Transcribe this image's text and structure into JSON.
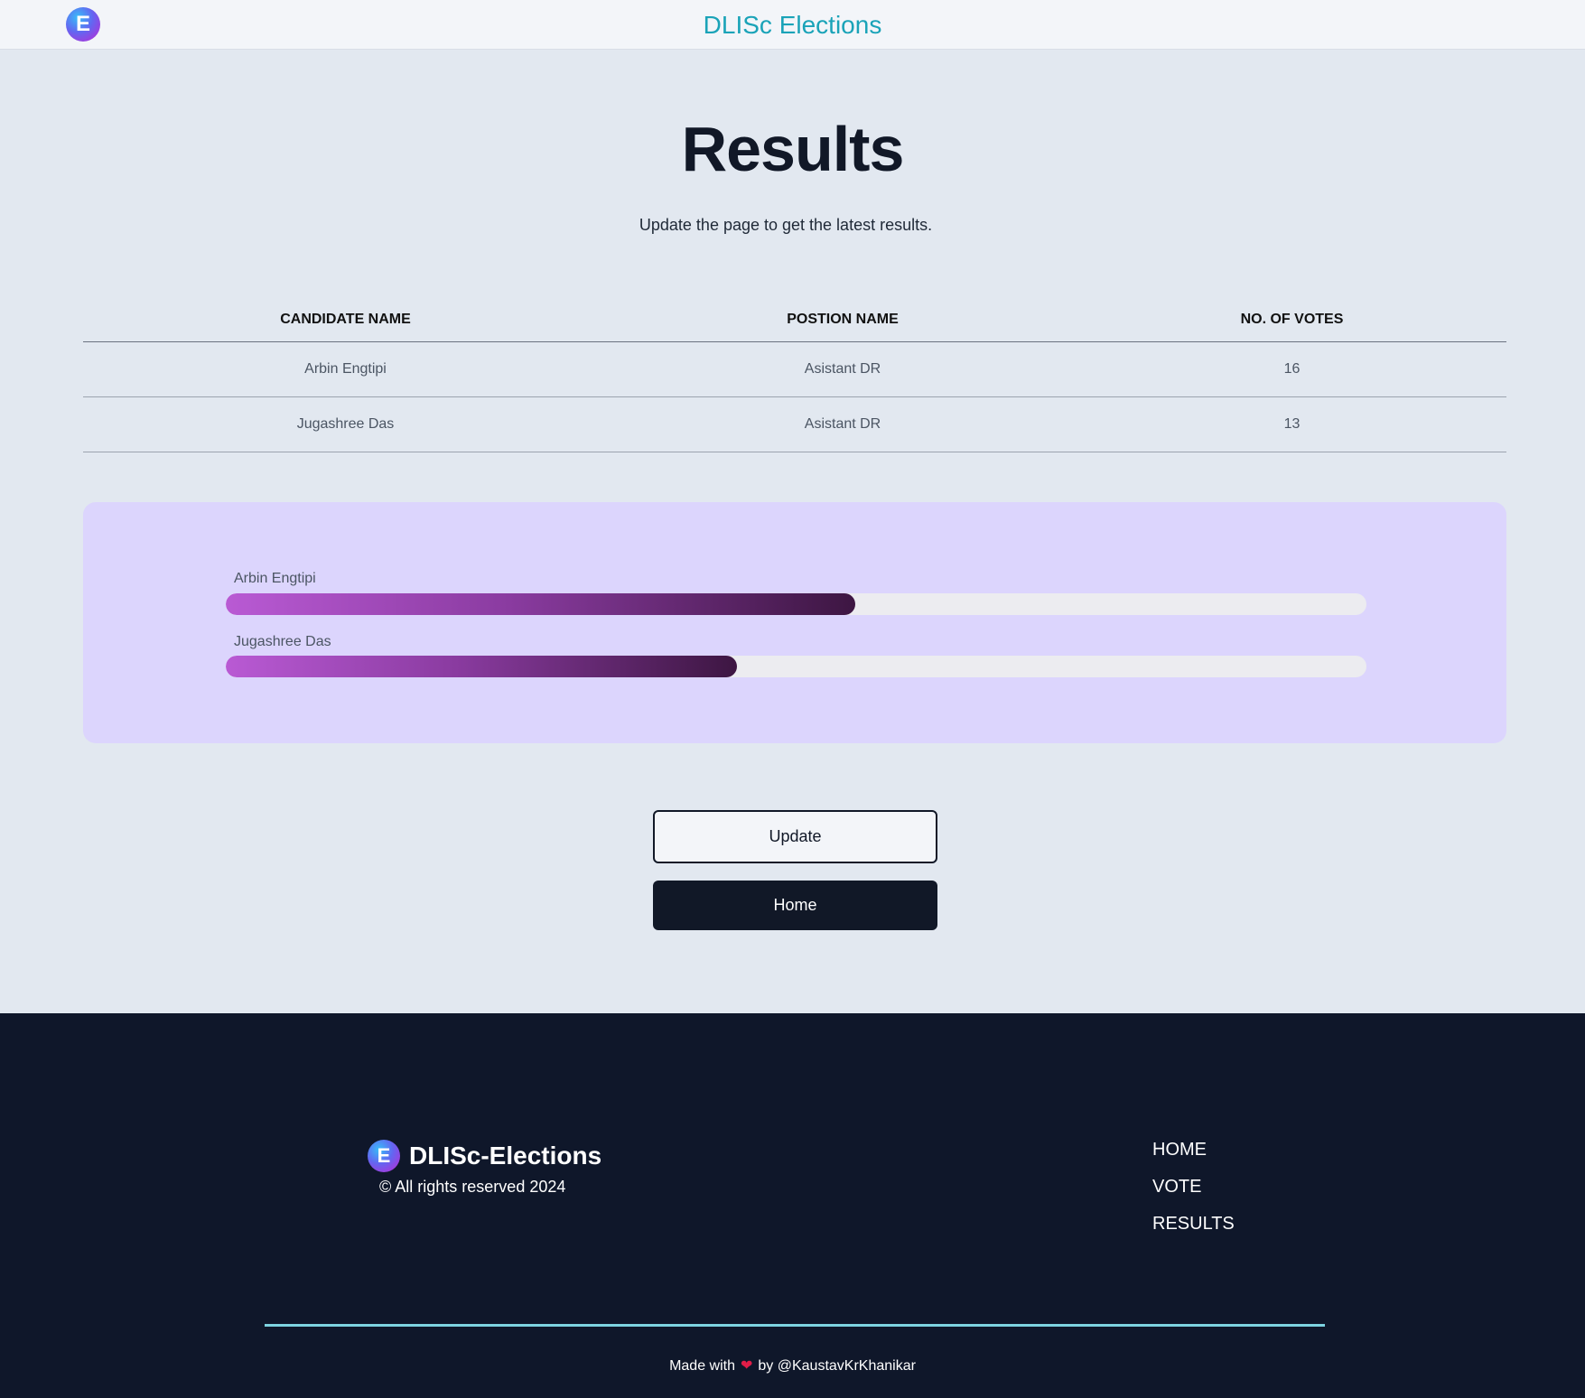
{
  "navbar": {
    "logo_letter": "E",
    "title": "DLISc Elections"
  },
  "page": {
    "title": "Results",
    "subtitle": "Update the page to get the latest results."
  },
  "table": {
    "headers": [
      "CANDIDATE NAME",
      "POSTION NAME",
      "NO. OF VOTES"
    ],
    "rows": [
      {
        "candidate": "Arbin Engtipi",
        "position": "Asistant DR",
        "votes": "16"
      },
      {
        "candidate": "Jugashree Das",
        "position": "Asistant DR",
        "votes": "13"
      }
    ]
  },
  "bars": [
    {
      "label": "Arbin Engtipi",
      "fill_percent": 55.2
    },
    {
      "label": "Jugashree Das",
      "fill_percent": 44.8
    }
  ],
  "buttons": {
    "update_label": "Update",
    "home_label": "Home"
  },
  "footer": {
    "logo_letter": "E",
    "brand": "DLISc-Elections",
    "copyright": "© All rights reserved 2024",
    "links": [
      "HOME",
      "VOTE",
      "RESULTS"
    ],
    "credit_prefix": "Made with",
    "credit_suffix": "by @KaustavKrKhanikar"
  },
  "colors": {
    "accent": "#1aa3b8",
    "panel": "#dcd5fd",
    "footer_bg": "#0f172a",
    "bar_start": "#b95ad4",
    "bar_end": "#3d1642"
  }
}
